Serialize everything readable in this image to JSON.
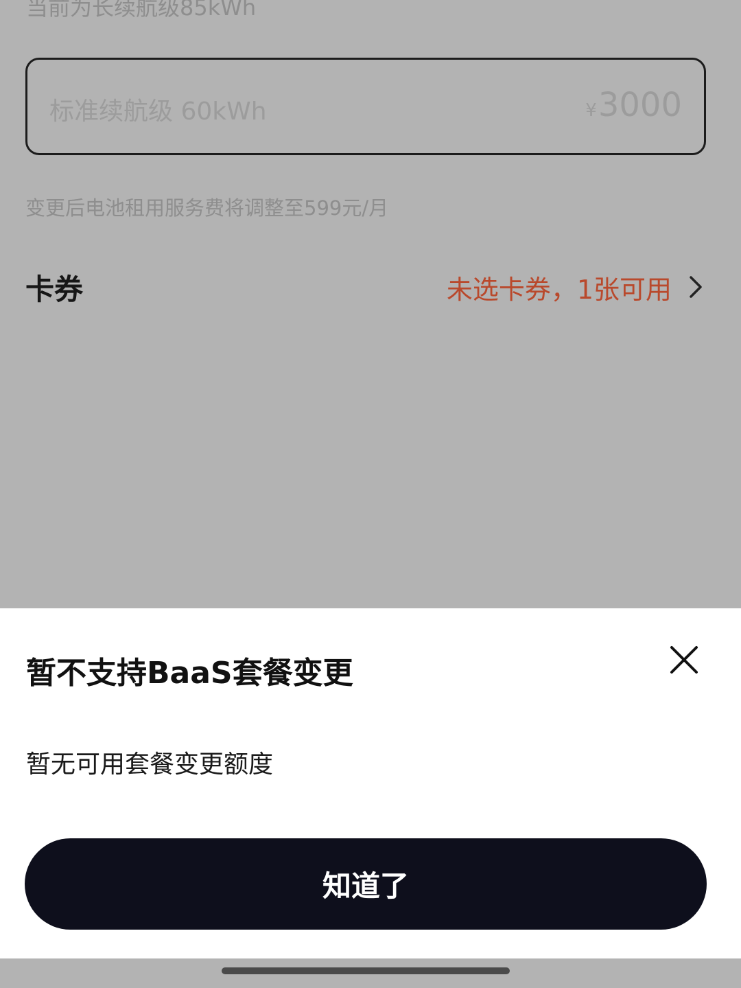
{
  "background_page": {
    "current_plan_text": "当前为长续航级85kWh",
    "option": {
      "name": "标准续航级 60kWh",
      "currency": "¥",
      "price": "3000"
    },
    "fee_note": "变更后电池租用服务费将调整至599元/月",
    "coupon": {
      "label": "卡券",
      "status": "未选卡券，1张可用",
      "status_color": "#b9492c",
      "icon": "chevron-right-icon"
    }
  },
  "sheet": {
    "title": "暂不支持BaaS套餐变更",
    "close_icon": "close-icon",
    "message": "暂无可用套餐变更额度",
    "confirm_label": "知道了",
    "button_color": "#0e0f1c"
  }
}
